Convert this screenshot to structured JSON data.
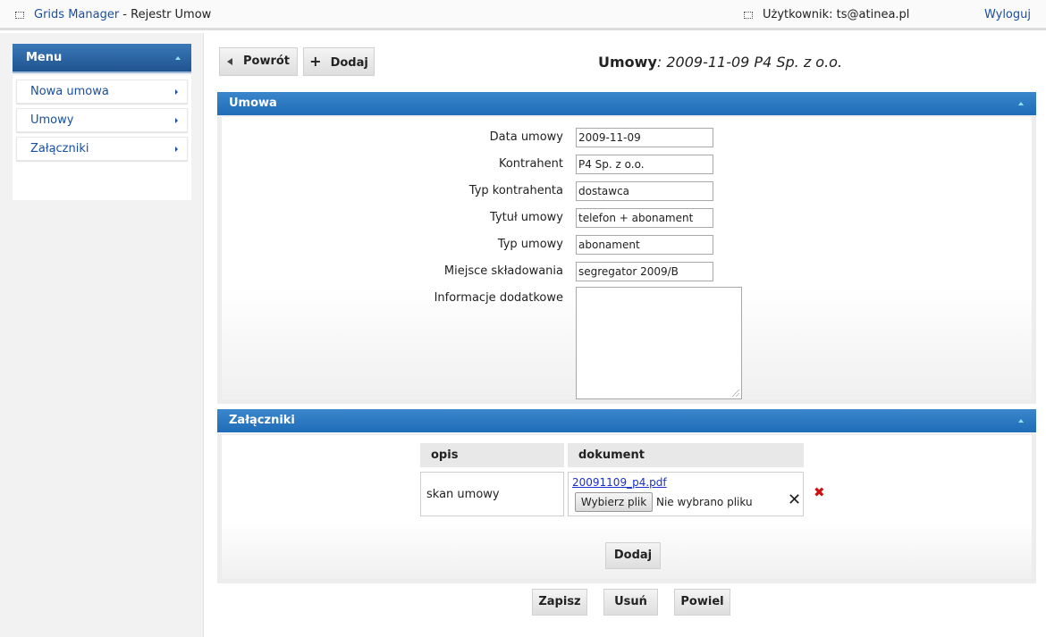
{
  "topbar": {
    "app_name": "Grids Manager",
    "separator": " - ",
    "page_name": "Rejestr Umow",
    "user_label": "Użytkownik: ts@atinea.pl",
    "logout": "Wyloguj"
  },
  "sidebar": {
    "title": "Menu",
    "items": [
      {
        "label": "Nowa umowa"
      },
      {
        "label": "Umowy"
      },
      {
        "label": "Załączniki"
      }
    ]
  },
  "toolbar": {
    "back": "Powrót",
    "add": "Dodaj"
  },
  "page_title": {
    "label": "Umowy",
    "suffix": ": 2009-11-09 P4 Sp. z o.o."
  },
  "umowa": {
    "title": "Umowa",
    "fields": [
      {
        "label": "Data umowy",
        "value": "2009-11-09"
      },
      {
        "label": "Kontrahent",
        "value": "P4 Sp. z o.o."
      },
      {
        "label": "Typ kontrahenta",
        "value": "dostawca"
      },
      {
        "label": "Tytuł umowy",
        "value": "telefon + abonament"
      },
      {
        "label": "Typ umowy",
        "value": "abonament"
      },
      {
        "label": "Miejsce składowania",
        "value": "segregator 2009/B"
      },
      {
        "label": "Informacje dodatkowe",
        "value": ""
      }
    ]
  },
  "zalaczniki": {
    "title": "Załączniki",
    "columns": [
      "opis",
      "dokument"
    ],
    "rows": [
      {
        "opis": "skan umowy",
        "file": "20091109_p4.pdf",
        "choose": "Wybierz plik",
        "no_file": "Nie wybrano pliku",
        "clear": "✕",
        "delete": "✖"
      }
    ],
    "add": "Dodaj"
  },
  "actions": {
    "save": "Zapisz",
    "delete": "Usuń",
    "duplicate": "Powiel"
  }
}
